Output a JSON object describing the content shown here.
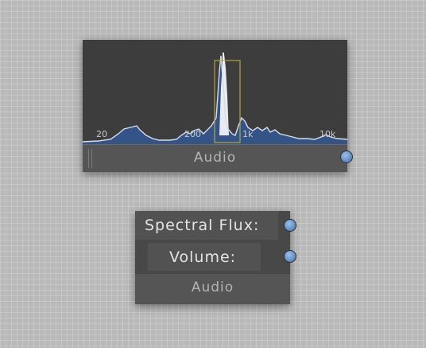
{
  "audio_node": {
    "title": "Audio",
    "ticks": [
      "20",
      "200",
      "1k",
      "10k"
    ]
  },
  "features_node": {
    "outputs": [
      {
        "label": "Spectral Flux:"
      },
      {
        "label": "Volume:"
      }
    ],
    "title": "Audio"
  },
  "colors": {
    "canvas": "#b9b9b9",
    "node_body": "#4a4a4a",
    "spectrum_fill": "#34558c",
    "spectrum_stroke": "#d8dde6",
    "selection_box": "#b4a63a",
    "port": "#7aa3d8"
  }
}
